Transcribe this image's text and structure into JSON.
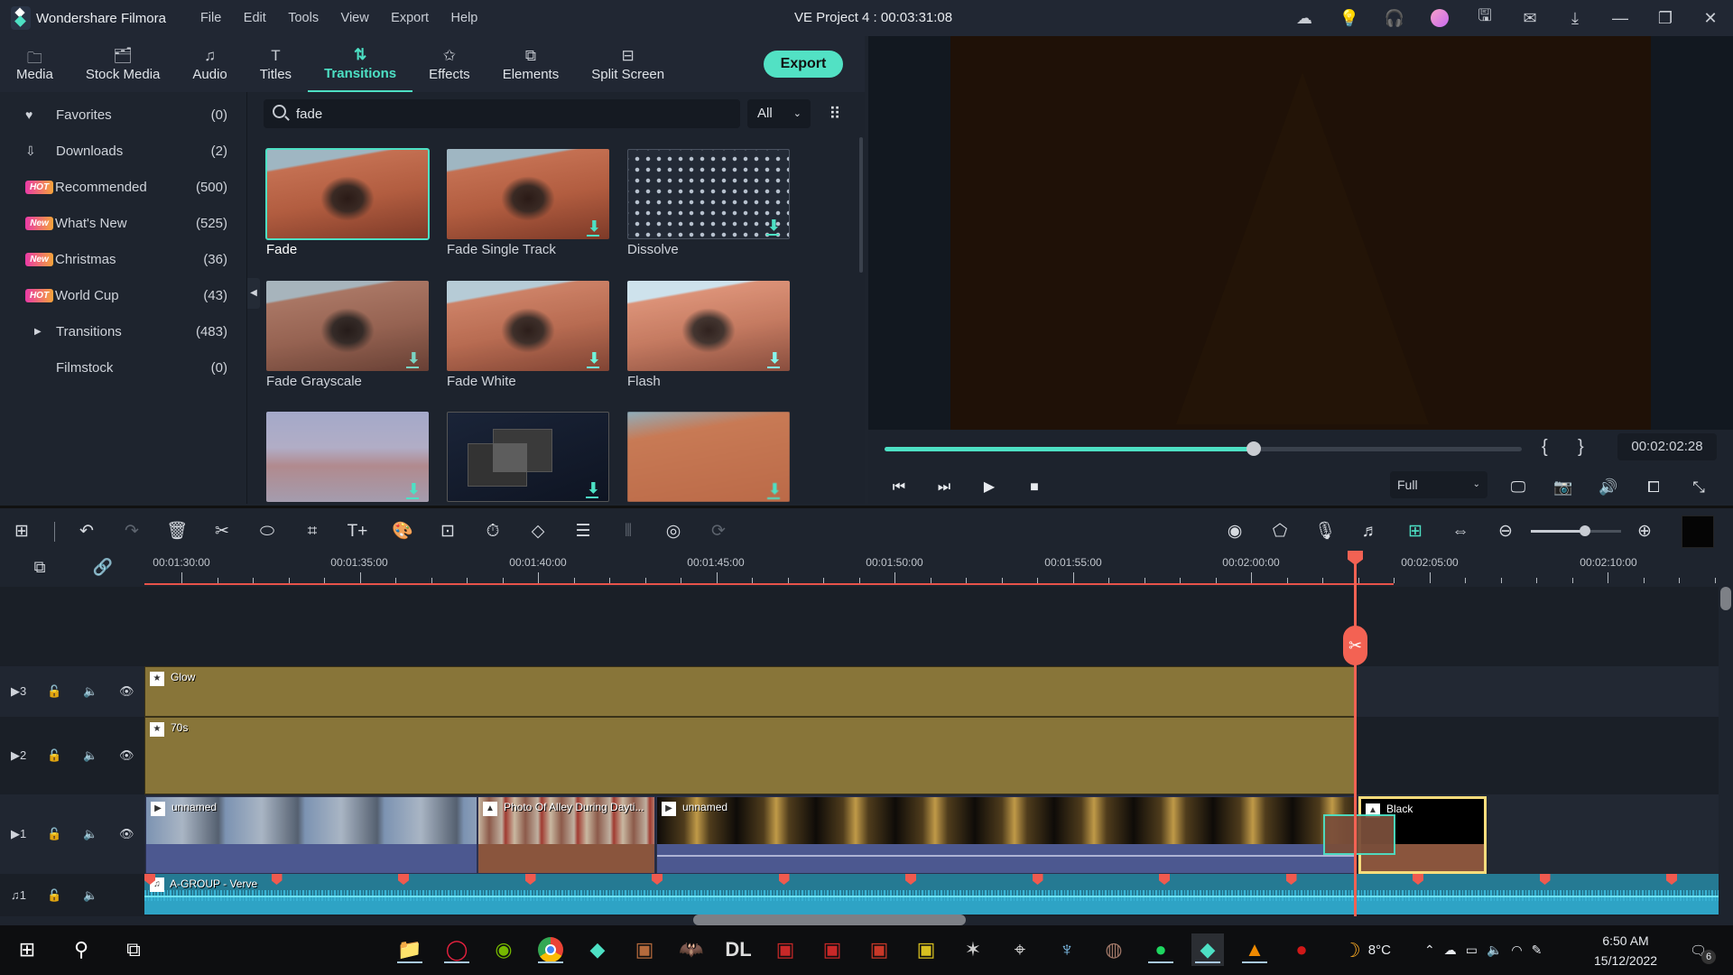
{
  "app": {
    "name": "Wondershare Filmora",
    "project_title": "VE Project 4 : 00:03:31:08",
    "menu": [
      "File",
      "Edit",
      "Tools",
      "View",
      "Export",
      "Help"
    ],
    "title_icons": [
      "cloud-icon",
      "lightbulb-icon",
      "headset-icon",
      "avatar-icon",
      "save-icon",
      "mail-icon",
      "download-icon"
    ],
    "window_controls": [
      "minimize",
      "restore",
      "close"
    ]
  },
  "library_tabs": [
    {
      "label": "Media",
      "icon": "folder-icon"
    },
    {
      "label": "Stock Media",
      "icon": "stock-media-icon"
    },
    {
      "label": "Audio",
      "icon": "music-note-icon"
    },
    {
      "label": "Titles",
      "icon": "text-icon"
    },
    {
      "label": "Transitions",
      "icon": "transitions-icon",
      "active": true
    },
    {
      "label": "Effects",
      "icon": "effects-icon"
    },
    {
      "label": "Elements",
      "icon": "elements-icon"
    },
    {
      "label": "Split Screen",
      "icon": "split-screen-icon"
    }
  ],
  "export_label": "Export",
  "sidebar": {
    "items": [
      {
        "label": "Favorites",
        "count": "(0)",
        "icon": "heart-icon"
      },
      {
        "label": "Downloads",
        "count": "(2)",
        "icon": "download-icon"
      },
      {
        "label": "Recommended",
        "count": "(500)",
        "badge": "HOT"
      },
      {
        "label": "What's New",
        "count": "(525)",
        "badge": "New"
      },
      {
        "label": "Christmas",
        "count": "(36)",
        "badge": "New"
      },
      {
        "label": "World Cup",
        "count": "(43)",
        "badge": "HOT"
      },
      {
        "label": "Transitions",
        "count": "(483)",
        "icon": "expand-arrow-icon"
      },
      {
        "label": "Filmstock",
        "count": "(0)"
      }
    ]
  },
  "search": {
    "value": "fade",
    "placeholder": "Search"
  },
  "filter": {
    "selected": "All"
  },
  "transitions": [
    {
      "label": "Fade",
      "selected": true,
      "download": false
    },
    {
      "label": "Fade Single Track",
      "download": true
    },
    {
      "label": "Dissolve",
      "download": true
    },
    {
      "label": "Fade Grayscale",
      "download": true
    },
    {
      "label": "Fade White",
      "download": true
    },
    {
      "label": "Flash",
      "download": true
    },
    {
      "label": "",
      "download": true
    },
    {
      "label": "",
      "download": true
    },
    {
      "label": "",
      "download": true
    }
  ],
  "player": {
    "progress": 0.58,
    "timecode": "00:02:02:28",
    "mark_in": "{",
    "mark_out": "}",
    "quality": "Full",
    "controls": [
      "prev-frame",
      "next-frame",
      "play",
      "stop"
    ],
    "right_icons": [
      "display-icon",
      "snapshot-icon",
      "volume-icon",
      "crop-ratio-icon",
      "fullscreen-icon"
    ]
  },
  "toolbar": {
    "zoom_level": 0.6,
    "left_icons": [
      "layout-icon",
      "undo-icon",
      "redo-icon",
      "delete-icon",
      "cut-icon",
      "tag-icon",
      "crop-icon",
      "text-add-icon",
      "color-icon",
      "green-screen-icon",
      "speed-icon",
      "keyframe-icon",
      "adjust-icon",
      "audio-mix-icon",
      "stabilize-icon",
      "speech-to-text-icon"
    ],
    "right_icons": [
      "render-icon",
      "marker-icon",
      "microphone-icon",
      "audio-ducking-icon",
      "snap-icon",
      "fit-icon",
      "zoom-out-icon",
      "zoom-in-icon"
    ]
  },
  "timeline": {
    "ruler_labels": [
      "00:01:30:00",
      "00:01:35:00",
      "00:01:40:00",
      "00:01:45:00",
      "00:01:50:00",
      "00:01:55:00",
      "00:02:00:00",
      "00:02:05:00",
      "00:02:10:00"
    ],
    "tracks": [
      {
        "type": "video",
        "number": "3",
        "clips": [
          {
            "name": "Glow",
            "kind": "effect"
          }
        ]
      },
      {
        "type": "video",
        "number": "2",
        "clips": [
          {
            "name": "70s",
            "kind": "effect"
          }
        ]
      },
      {
        "type": "video",
        "number": "1",
        "clips": [
          {
            "name": "unnamed",
            "kind": "video"
          },
          {
            "name": "Photo Of Alley During Dayti...",
            "kind": "image"
          },
          {
            "name": "unnamed",
            "kind": "video"
          },
          {
            "name": "Black",
            "kind": "image",
            "selected": true
          }
        ]
      },
      {
        "type": "audio",
        "number": "1",
        "clips": [
          {
            "name": "A-GROUP - Verve",
            "kind": "audio"
          }
        ]
      }
    ]
  },
  "taskbar": {
    "apps": [
      "File Explorer",
      "Opera GX",
      "NVIDIA",
      "Chrome",
      "Filmora",
      "Game 1",
      "Batman",
      "Dying Light",
      "Evil West",
      "Red Dead",
      "Game 2",
      "Game 3",
      "Witcher",
      "Crosshair",
      "Game 4",
      "Jedi",
      "Spotify",
      "Filmora",
      "VLC",
      "Game 5"
    ],
    "weather": "8°C",
    "time": "6:50 AM",
    "date": "15/12/2022",
    "notifications": "6"
  }
}
